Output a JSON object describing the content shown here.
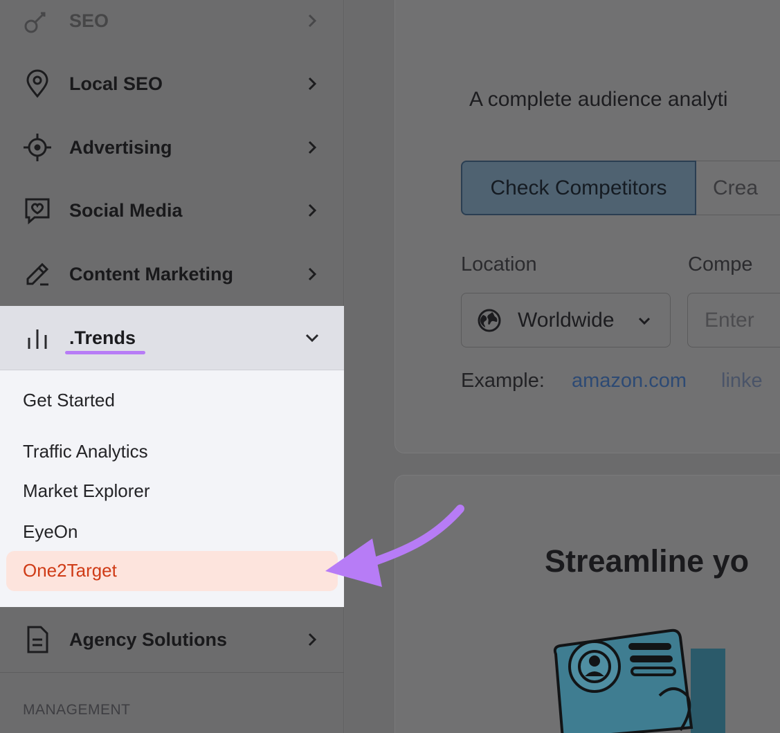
{
  "sidebar": {
    "items_above": [
      {
        "label": "SEO",
        "icon": "seo-icon"
      },
      {
        "label": "Local SEO",
        "icon": "location-pin-icon"
      },
      {
        "label": "Advertising",
        "icon": "target-icon"
      },
      {
        "label": "Social Media",
        "icon": "chat-heart-icon"
      },
      {
        "label": "Content Marketing",
        "icon": "pencil-icon"
      }
    ],
    "trends": {
      "label": ".Trends",
      "icon": "bar-chart-icon"
    },
    "submenu": [
      {
        "label": "Get Started"
      },
      {
        "label": "Traffic Analytics"
      },
      {
        "label": "Market Explorer"
      },
      {
        "label": "EyeOn"
      },
      {
        "label": "One2Target"
      }
    ],
    "agency": {
      "label": "Agency Solutions",
      "icon": "document-icon"
    },
    "section_label": "MANAGEMENT"
  },
  "main": {
    "subtitle": "A complete audience analyti",
    "tabs": [
      {
        "label": "Check Competitors"
      },
      {
        "label": "Crea"
      }
    ],
    "location_label": "Location",
    "competitors_label": "Compe",
    "location_value": "Worldwide",
    "competitor_placeholder": "Enter",
    "example_label": "Example:",
    "examples": [
      "amazon.com",
      "linke"
    ],
    "streamline_title": "Streamline yo"
  },
  "colors": {
    "accent_purple": "#b77cf6",
    "highlight_bg": "#fde4dd",
    "highlight_text": "#cf3b16"
  }
}
